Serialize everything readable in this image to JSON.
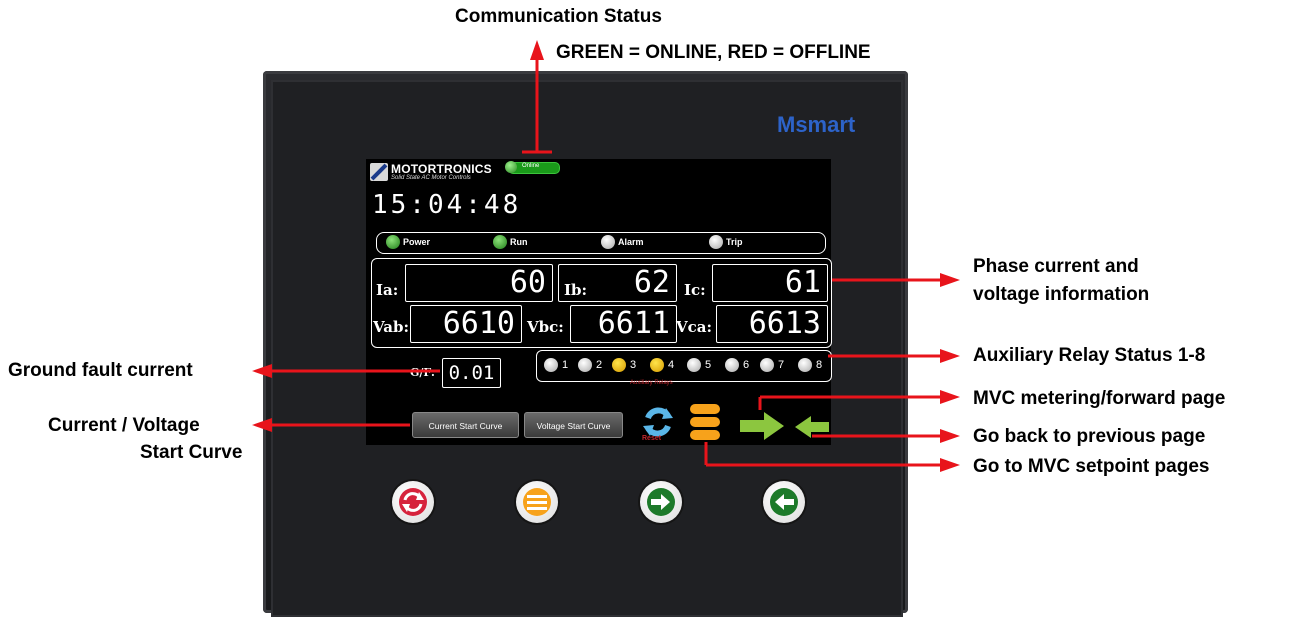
{
  "callouts": {
    "comm_title": "Communication Status",
    "comm_detail": "GREEN = ONLINE, RED = OFFLINE",
    "phase_line1": "Phase current and",
    "phase_line2": "voltage information",
    "aux_relay": "Auxiliary Relay Status 1-8",
    "mvc_forward": "MVC metering/forward page",
    "go_back": "Go back to previous page",
    "setpoint": "Go to MVC setpoint pages",
    "ground_fault": "Ground fault current",
    "curve_line1": "Current / Voltage",
    "curve_line2": "Start Curve"
  },
  "device": {
    "brand": "Msmart"
  },
  "screen": {
    "logo_title": "MOTORTRONICS",
    "logo_subtitle": "Solid State AC Motor Controls",
    "comm_status": "Online",
    "clock": "15:04:48",
    "status_indicators": [
      {
        "label": "Power",
        "state": "green"
      },
      {
        "label": "Run",
        "state": "green"
      },
      {
        "label": "Alarm",
        "state": "off"
      },
      {
        "label": "Trip",
        "state": "off"
      }
    ],
    "currents": [
      {
        "label": "Ia:",
        "value": "60"
      },
      {
        "label": "Ib:",
        "value": "62"
      },
      {
        "label": "Ic:",
        "value": "61"
      }
    ],
    "voltages": [
      {
        "label": "Vab:",
        "value": "6610"
      },
      {
        "label": "Vbc:",
        "value": "6611"
      },
      {
        "label": "Vca:",
        "value": "6613"
      }
    ],
    "ground_fault": {
      "label": "G/F:",
      "value": "0.01"
    },
    "relays": [
      {
        "num": "1",
        "state": "off"
      },
      {
        "num": "2",
        "state": "off"
      },
      {
        "num": "3",
        "state": "on"
      },
      {
        "num": "4",
        "state": "on"
      },
      {
        "num": "5",
        "state": "off"
      },
      {
        "num": "6",
        "state": "off"
      },
      {
        "num": "7",
        "state": "off"
      },
      {
        "num": "8",
        "state": "off"
      }
    ],
    "relay_caption": "Auxiliary Relays",
    "buttons": {
      "current_curve": "Current Start Curve",
      "voltage_curve": "Voltage Start Curve",
      "reset_caption": "Reset"
    }
  },
  "colors": {
    "online": "#1a9a1a",
    "relay_on": "#f2c200",
    "callout_arrow": "#e8141b",
    "brand": "#2d63c9"
  },
  "icons": [
    "reset-icon",
    "menu-icon",
    "forward-arrow-icon",
    "back-arrow-icon"
  ]
}
